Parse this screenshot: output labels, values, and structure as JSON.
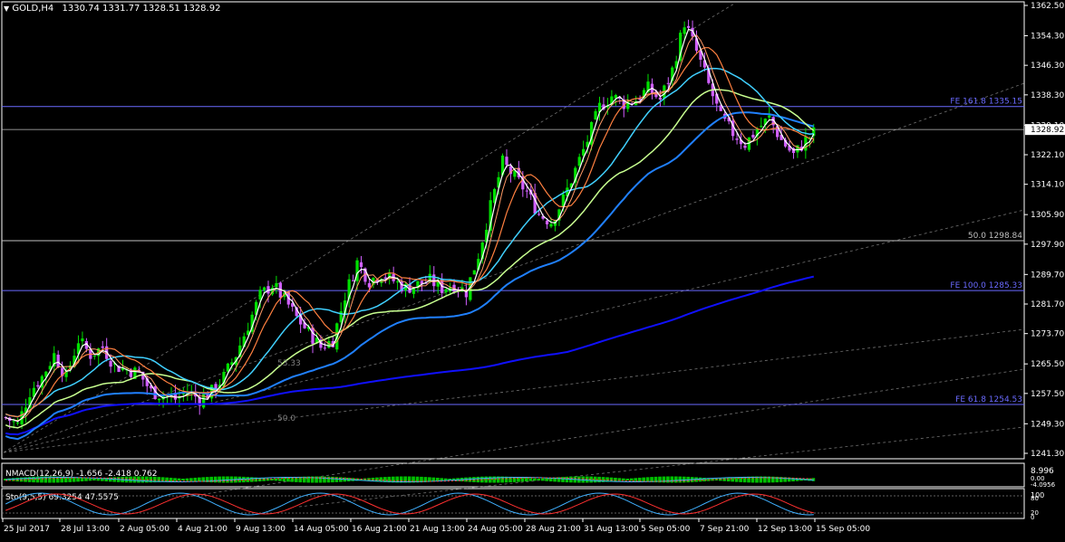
{
  "header": {
    "symbol": "GOLD,H4",
    "ohlc": "1330.74 1331.77 1328.51 1328.92"
  },
  "price_axis": {
    "labels": [
      "1362.50",
      "1354.30",
      "1346.30",
      "1338.30",
      "1330.10",
      "1322.10",
      "1314.10",
      "1305.90",
      "1297.90",
      "1289.70",
      "1281.70",
      "1273.70",
      "1265.50",
      "1257.50",
      "1249.30",
      "1241.30"
    ],
    "current_price": "1328.92"
  },
  "levels": [
    {
      "label": "FE 161.8 1335.15",
      "value": 1335.15,
      "color": "#6a6aff"
    },
    {
      "label": "50.0 1298.84",
      "value": 1298.84,
      "color": "#c0c0c0"
    },
    {
      "label": "FE 100.0  1285.33",
      "value": 1285.33,
      "color": "#6a6aff"
    },
    {
      "label": "FE 61.8 1254.53",
      "value": 1254.53,
      "color": "#6a6aff"
    }
  ],
  "extra_labels": [
    {
      "text": "50.0",
      "color": "#808080"
    },
    {
      "text": "53.33",
      "color": "#808080"
    }
  ],
  "macd": {
    "label": "NMACD(12,26,9) -1.656 -2.418 0.762",
    "axis_labels": [
      "8.996",
      "0.00",
      "-4.0956"
    ]
  },
  "stoch": {
    "label": "Sto(9,5,5) 69.3254 47.5575",
    "axis_labels": [
      "100",
      "80",
      "20",
      "0"
    ]
  },
  "time_axis": {
    "labels": [
      "25 Jul 2017",
      "28 Jul 13:00",
      "2 Aug 05:00",
      "4 Aug 21:00",
      "9 Aug 13:00",
      "14 Aug 05:00",
      "16 Aug 21:00",
      "21 Aug 13:00",
      "24 Aug 05:00",
      "28 Aug 21:00",
      "31 Aug 13:00",
      "5 Sep 05:00",
      "7 Sep 21:00",
      "12 Sep 13:00",
      "15 Sep 05:00"
    ]
  },
  "colors": {
    "bull": "#00e000",
    "bear": "#d060ff",
    "white_ma": "#ffffff",
    "salmon_ma": "#ff9966",
    "orange_ma": "#ff8040",
    "cyan_ma": "#40d0ff",
    "green_ma": "#c8ff90",
    "blue_ma": "#2080ff",
    "dark_blue_ma": "#1010ff"
  },
  "chart_data": {
    "type": "candlestick",
    "title": "GOLD,H4",
    "ylim": [
      1240,
      1363
    ],
    "close_path": [
      [
        0,
        1251
      ],
      [
        3,
        1249
      ],
      [
        6,
        1258
      ],
      [
        9,
        1262
      ],
      [
        12,
        1268
      ],
      [
        15,
        1262
      ],
      [
        18,
        1272
      ],
      [
        21,
        1268
      ],
      [
        24,
        1270
      ],
      [
        27,
        1265
      ],
      [
        30,
        1264
      ],
      [
        33,
        1263
      ],
      [
        36,
        1258
      ],
      [
        39,
        1257
      ],
      [
        42,
        1256
      ],
      [
        45,
        1258
      ],
      [
        48,
        1256
      ],
      [
        51,
        1258
      ],
      [
        54,
        1262
      ],
      [
        57,
        1268
      ],
      [
        60,
        1276
      ],
      [
        63,
        1284
      ],
      [
        66,
        1287
      ],
      [
        69,
        1283
      ],
      [
        72,
        1278
      ],
      [
        75,
        1274
      ],
      [
        78,
        1270
      ],
      [
        81,
        1272
      ],
      [
        84,
        1284
      ],
      [
        87,
        1293
      ],
      [
        90,
        1288
      ],
      [
        93,
        1290
      ],
      [
        96,
        1288
      ],
      [
        99,
        1286
      ],
      [
        102,
        1287
      ],
      [
        105,
        1288
      ],
      [
        108,
        1286
      ],
      [
        111,
        1287
      ],
      [
        114,
        1285
      ],
      [
        117,
        1295
      ],
      [
        120,
        1308
      ],
      [
        123,
        1320
      ],
      [
        126,
        1316
      ],
      [
        129,
        1312
      ],
      [
        132,
        1306
      ],
      [
        135,
        1304
      ],
      [
        138,
        1310
      ],
      [
        141,
        1318
      ],
      [
        144,
        1326
      ],
      [
        147,
        1335
      ],
      [
        150,
        1338
      ],
      [
        153,
        1336
      ],
      [
        156,
        1337
      ],
      [
        159,
        1340
      ],
      [
        162,
        1337
      ],
      [
        165,
        1345
      ],
      [
        168,
        1358
      ],
      [
        171,
        1350
      ],
      [
        174,
        1341
      ],
      [
        177,
        1332
      ],
      [
        180,
        1328
      ],
      [
        183,
        1325
      ],
      [
        186,
        1329
      ],
      [
        189,
        1332
      ],
      [
        192,
        1326
      ],
      [
        195,
        1322
      ],
      [
        198,
        1326
      ],
      [
        201,
        1329
      ]
    ]
  }
}
